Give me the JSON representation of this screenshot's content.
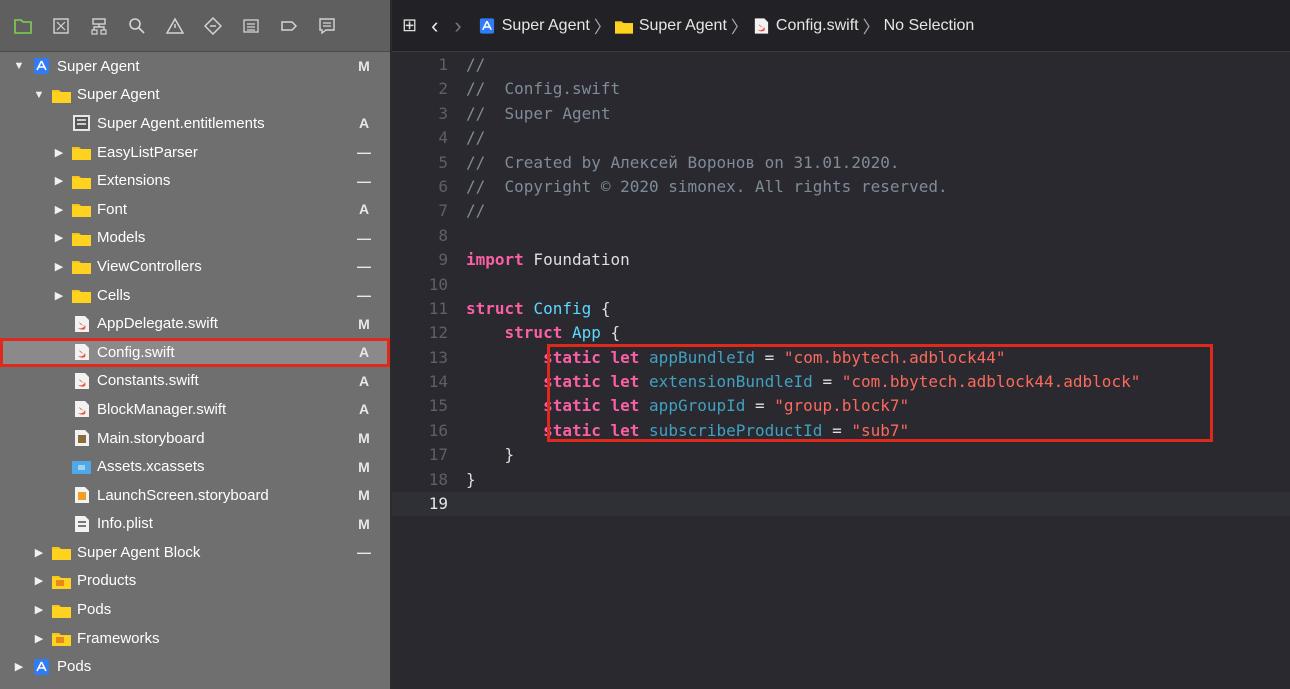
{
  "navigator": {
    "toolbar": [
      "project-navigator",
      "source-control-navigator",
      "symbol-navigator",
      "find-navigator",
      "issue-navigator",
      "test-navigator",
      "debug-navigator",
      "breakpoint-navigator",
      "report-navigator"
    ],
    "items": [
      {
        "label": "Super Agent",
        "depth": 0,
        "disclosure": "open",
        "icon": "project",
        "status": "M"
      },
      {
        "label": "Super Agent",
        "depth": 1,
        "disclosure": "open",
        "icon": "folder",
        "status": ""
      },
      {
        "label": "Super Agent.entitlements",
        "depth": 2,
        "disclosure": "none",
        "icon": "entitlements",
        "status": "A"
      },
      {
        "label": "EasyListParser",
        "depth": 2,
        "disclosure": "closed",
        "icon": "folder",
        "status": "—"
      },
      {
        "label": "Extensions",
        "depth": 2,
        "disclosure": "closed",
        "icon": "folder",
        "status": "—"
      },
      {
        "label": "Font",
        "depth": 2,
        "disclosure": "closed",
        "icon": "folder",
        "status": "A"
      },
      {
        "label": "Models",
        "depth": 2,
        "disclosure": "closed",
        "icon": "folder",
        "status": "—"
      },
      {
        "label": "ViewControllers",
        "depth": 2,
        "disclosure": "closed",
        "icon": "folder",
        "status": "—"
      },
      {
        "label": "Cells",
        "depth": 2,
        "disclosure": "closed",
        "icon": "folder",
        "status": "—"
      },
      {
        "label": "AppDelegate.swift",
        "depth": 2,
        "disclosure": "none",
        "icon": "swift",
        "status": "M"
      },
      {
        "label": "Config.swift",
        "depth": 2,
        "disclosure": "none",
        "icon": "swift",
        "status": "A",
        "selected": true
      },
      {
        "label": "Constants.swift",
        "depth": 2,
        "disclosure": "none",
        "icon": "swift",
        "status": "A"
      },
      {
        "label": "BlockManager.swift",
        "depth": 2,
        "disclosure": "none",
        "icon": "swift",
        "status": "A"
      },
      {
        "label": "Main.storyboard",
        "depth": 2,
        "disclosure": "none",
        "icon": "storyboard",
        "status": "M"
      },
      {
        "label": "Assets.xcassets",
        "depth": 2,
        "disclosure": "none",
        "icon": "assets",
        "status": "M"
      },
      {
        "label": "LaunchScreen.storyboard",
        "depth": 2,
        "disclosure": "none",
        "icon": "launch",
        "status": "M"
      },
      {
        "label": "Info.plist",
        "depth": 2,
        "disclosure": "none",
        "icon": "plist",
        "status": "M"
      },
      {
        "label": "Super Agent Block",
        "depth": 1,
        "disclosure": "closed",
        "icon": "folder",
        "status": "—"
      },
      {
        "label": "Products",
        "depth": 1,
        "disclosure": "closed",
        "icon": "folder-products",
        "status": ""
      },
      {
        "label": "Pods",
        "depth": 1,
        "disclosure": "closed",
        "icon": "folder",
        "status": ""
      },
      {
        "label": "Frameworks",
        "depth": 1,
        "disclosure": "closed",
        "icon": "folder-products",
        "status": ""
      },
      {
        "label": "Pods",
        "depth": 0,
        "disclosure": "closed",
        "icon": "project",
        "status": ""
      }
    ]
  },
  "jumpbar": {
    "crumbs": [
      {
        "label": "Super Agent",
        "icon": "project"
      },
      {
        "label": "Super Agent",
        "icon": "folder"
      },
      {
        "label": "Config.swift",
        "icon": "swift"
      },
      {
        "label": "No Selection",
        "icon": ""
      }
    ]
  },
  "editor": {
    "current_line": 19,
    "lines": [
      [
        [
          "t-com",
          "//"
        ]
      ],
      [
        [
          "t-com",
          "//  Config.swift"
        ]
      ],
      [
        [
          "t-com",
          "//  Super Agent"
        ]
      ],
      [
        [
          "t-com",
          "//"
        ]
      ],
      [
        [
          "t-com",
          "//  Created by Алексей Воронов on 31.01.2020."
        ]
      ],
      [
        [
          "t-com",
          "//  Copyright © 2020 simonex. All rights reserved."
        ]
      ],
      [
        [
          "t-com",
          "//"
        ]
      ],
      [],
      [
        [
          "t-kw",
          "import"
        ],
        [
          "t-plain",
          " Foundation"
        ]
      ],
      [],
      [
        [
          "t-kw",
          "struct"
        ],
        [
          "t-plain",
          " "
        ],
        [
          "t-type",
          "Config"
        ],
        [
          "t-plain",
          " {"
        ]
      ],
      [
        [
          "t-plain",
          "    "
        ],
        [
          "t-kw",
          "struct"
        ],
        [
          "t-plain",
          " "
        ],
        [
          "t-type",
          "App"
        ],
        [
          "t-plain",
          " {"
        ]
      ],
      [
        [
          "t-plain",
          "        "
        ],
        [
          "t-kw",
          "static"
        ],
        [
          "t-plain",
          " "
        ],
        [
          "t-kw",
          "let"
        ],
        [
          "t-plain",
          " "
        ],
        [
          "t-ident",
          "appBundleId"
        ],
        [
          "t-plain",
          " = "
        ],
        [
          "t-str",
          "\"com.bbytech.adblock44\""
        ]
      ],
      [
        [
          "t-plain",
          "        "
        ],
        [
          "t-kw",
          "static"
        ],
        [
          "t-plain",
          " "
        ],
        [
          "t-kw",
          "let"
        ],
        [
          "t-plain",
          " "
        ],
        [
          "t-ident",
          "extensionBundleId"
        ],
        [
          "t-plain",
          " = "
        ],
        [
          "t-str",
          "\"com.bbytech.adblock44.adblock\""
        ]
      ],
      [
        [
          "t-plain",
          "        "
        ],
        [
          "t-kw",
          "static"
        ],
        [
          "t-plain",
          " "
        ],
        [
          "t-kw",
          "let"
        ],
        [
          "t-plain",
          " "
        ],
        [
          "t-ident",
          "appGroupId"
        ],
        [
          "t-plain",
          " = "
        ],
        [
          "t-str",
          "\"group.block7\""
        ]
      ],
      [
        [
          "t-plain",
          "        "
        ],
        [
          "t-kw",
          "static"
        ],
        [
          "t-plain",
          " "
        ],
        [
          "t-kw",
          "let"
        ],
        [
          "t-plain",
          " "
        ],
        [
          "t-ident",
          "subscribeProductId"
        ],
        [
          "t-plain",
          " = "
        ],
        [
          "t-str",
          "\"sub7\""
        ]
      ],
      [
        [
          "t-plain",
          "    }"
        ]
      ],
      [
        [
          "t-plain",
          "}"
        ]
      ],
      []
    ]
  },
  "colors": {
    "navigator_bg": "#6f6f6f",
    "editor_bg": "#29292f",
    "annotation_red": "#e0291c",
    "keyword": "#fc5fa3",
    "string": "#fc6a5d",
    "comment": "#7f8c98",
    "type": "#5dd8ff"
  }
}
